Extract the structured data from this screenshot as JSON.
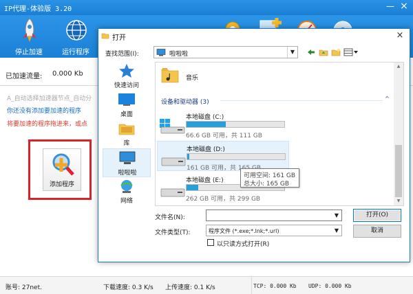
{
  "app": {
    "title": "IP代理-体验版 3.20",
    "minimize": "—",
    "close": "×",
    "toolbar": {
      "stop": "停止加速",
      "run": "运行程序"
    },
    "accel_label": "已加速流量:",
    "accel_value": "0.000 Kb",
    "messages": {
      "m1": "A_自动选择加速器节点_自动分",
      "m2": "你还没有添加要加速的程序",
      "m3": "将要加速的程序拖进来，或点"
    },
    "add_program": "添加程序",
    "status": {
      "account": "账号: 27net.",
      "download": "下载速度: 0.3 K/s",
      "upload": "上传速度: 0.1 K/s",
      "tcp": "TCP: 0.000 Kb",
      "udp": "UDP: 0.000 Kb"
    }
  },
  "dialog": {
    "title": "打开",
    "close": "×",
    "lookin_label": "查找范围(I):",
    "lookin_value": "啦啦啦",
    "dropdown_arrow": "▼",
    "places": [
      {
        "label": "快速访问",
        "icon": "star-icon"
      },
      {
        "label": "桌面",
        "icon": "desktop-icon"
      },
      {
        "label": "库",
        "icon": "library-icon"
      },
      {
        "label": "啦啦啦",
        "icon": "computer-icon"
      },
      {
        "label": "网络",
        "icon": "network-icon"
      }
    ],
    "music": "音乐",
    "group_header": "设备和驱动器 (3)",
    "group_chevron": "^",
    "drives": [
      {
        "name": "本地磁盘 (C:)",
        "space": "66.6 GB 可用，共 111 GB",
        "used_percent": 40
      },
      {
        "name": "本地磁盘 (D:)",
        "space": "161 GB 可用，共 165 GB",
        "used_percent": 2
      },
      {
        "name": "本地磁盘 (E:)",
        "space": "262 GB 可用，共 299 GB",
        "used_percent": 12
      }
    ],
    "tooltip": {
      "free": "可用空间: 161 GB",
      "total": "总大小: 165 GB"
    },
    "filename_label": "文件名(N):",
    "filename_value": "",
    "filetype_label": "文件类型(T):",
    "filetype_value": "程序文件 (*.exe;*.lnk;*.url)",
    "readonly_label": "以只读方式打开(R)",
    "open_button": "打开(O)",
    "cancel_button": "取消"
  },
  "colors": {
    "accent": "#1a7fd4",
    "drive_fill": "#26a0da",
    "highlight_frame": "#d8232a"
  }
}
